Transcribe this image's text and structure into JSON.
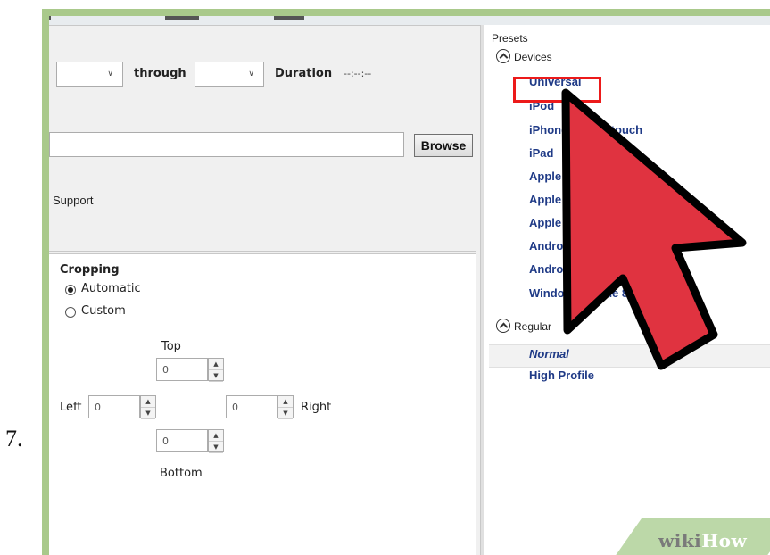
{
  "step_number": "7.",
  "range": {
    "through_label": "through",
    "duration_label": "Duration",
    "duration_value": "--:--:--"
  },
  "destination": {
    "file_value": "",
    "browse_label": "Browse"
  },
  "support_label": "Support",
  "cropping": {
    "title": "Cropping",
    "options": [
      "Automatic",
      "Custom"
    ],
    "selected": "Automatic",
    "top_label": "Top",
    "bottom_label": "Bottom",
    "left_label": "Left",
    "right_label": "Right",
    "top_value": "0",
    "bottom_value": "0",
    "left_value": "0",
    "right_value": "0"
  },
  "presets": {
    "title": "Presets",
    "groups": [
      {
        "name": "Devices",
        "items": [
          "Universal",
          "iPod",
          "iPhone & iPod touch",
          "iPad",
          "Apple",
          "Apple",
          "Apple",
          "Andro",
          "Andro",
          "Windows Phone 8"
        ]
      },
      {
        "name": "Regular",
        "items": [
          "Normal",
          "High Profile"
        ]
      }
    ],
    "highlighted": "Universal",
    "selected_row": "Normal"
  },
  "watermark": {
    "wiki": "wiki",
    "how": "How"
  },
  "colors": {
    "frame": "#a9c98b",
    "preset_text": "#203b87",
    "highlight_box": "#ec1a1a",
    "arrow_fill": "#e03340",
    "arrow_outline": "#000000"
  }
}
